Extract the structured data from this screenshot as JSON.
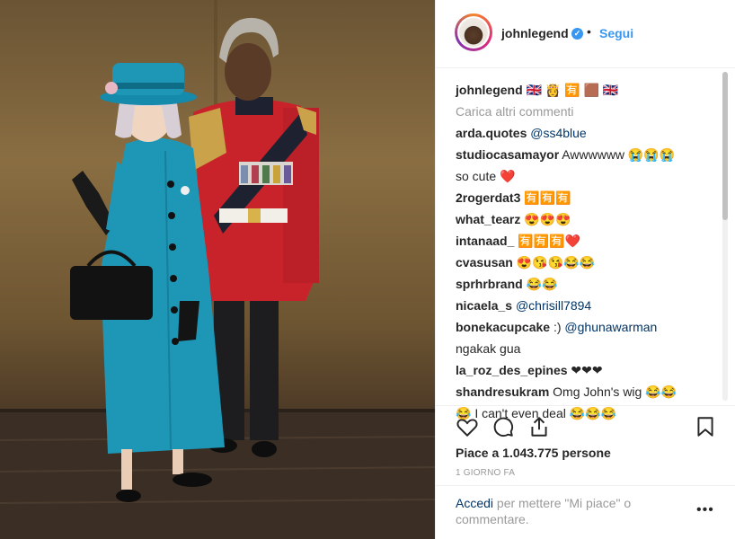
{
  "header": {
    "username": "johnlegend",
    "verified_mark": "✓",
    "separator": "•",
    "follow_label": "Segui"
  },
  "comments": {
    "load_more": "Carica altri commenti",
    "items": [
      {
        "user": "johnlegend",
        "text": "🇬🇧 👸 🈶 🟫 🇬🇧"
      },
      {
        "user": "arda.quotes",
        "mention": "@ss4blue",
        "text": ""
      },
      {
        "user": "studiocasamayor",
        "text": "Awwwwww 😭😭😭"
      },
      {
        "user": "",
        "text": "so cute ❤️"
      },
      {
        "user": "2rogerdat3",
        "text": "🈶🈶🈶"
      },
      {
        "user": "what_tearz",
        "text": "😍😍😍"
      },
      {
        "user": "intanaad_",
        "text": "🈶🈶🈶❤️"
      },
      {
        "user": "cvasusan",
        "text": "😍😘😘😂😂"
      },
      {
        "user": "sprhrbrand",
        "text": "😂😂"
      },
      {
        "user": "nicaela_s",
        "mention": "@chrisill7894",
        "text": ""
      },
      {
        "user": "bonekacupcake",
        "text": ":)",
        "mention": "@ghunawarman"
      },
      {
        "user": "",
        "text": "ngakak gua"
      },
      {
        "user": "la_roz_des_epines",
        "text": "❤❤❤"
      },
      {
        "user": "shandresukram",
        "text": "Omg John's wig 😂😂"
      },
      {
        "user": "",
        "text": "😂 I can't even deal 😂😂😂"
      }
    ]
  },
  "actions": {
    "like_icon": "heart-icon",
    "comment_icon": "comment-icon",
    "share_icon": "share-icon",
    "save_icon": "bookmark-icon"
  },
  "likes_text": "Piace a 1.043.775 persone",
  "time_text": "1 GIORNO FA",
  "footer": {
    "login_link": "Accedi",
    "login_rest": "per mettere \"Mi piace\" o commentare.",
    "more_label": "•••"
  },
  "colors": {
    "accent": "#3897f0",
    "text": "#262626",
    "muted": "#999999",
    "link": "#003569"
  }
}
